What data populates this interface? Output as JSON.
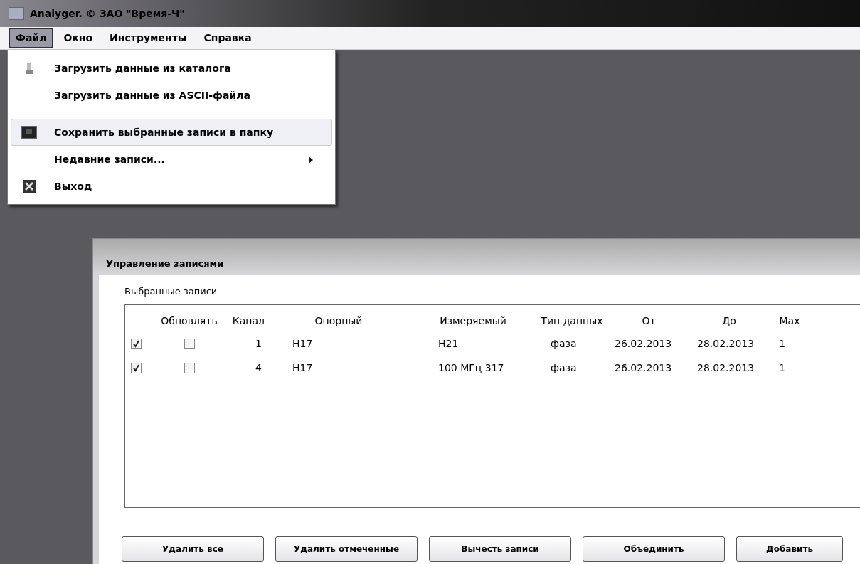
{
  "window": {
    "title": "Analyger. © ЗАО \"Время-Ч\""
  },
  "menu_bar": [
    {
      "label": "Файл",
      "selected": true
    },
    {
      "label": "Окно",
      "selected": false
    },
    {
      "label": "Инструменты",
      "selected": false
    },
    {
      "label": "Справка",
      "selected": false
    }
  ],
  "file_menu": [
    {
      "label": "Загрузить данные из каталога",
      "kind": "load",
      "highlighted": false,
      "submenu": false,
      "separator_after": false
    },
    {
      "label": "Загрузить данные из ASCII-файла",
      "kind": "plain",
      "highlighted": false,
      "submenu": false,
      "separator_after": true
    },
    {
      "label": "Сохранить выбранные записи в папку",
      "kind": "save",
      "highlighted": true,
      "submenu": false,
      "separator_after": false
    },
    {
      "label": "Недавние записи...",
      "kind": "plain",
      "highlighted": false,
      "submenu": true,
      "separator_after": false
    },
    {
      "label": "Выход",
      "kind": "exit",
      "highlighted": false,
      "submenu": false,
      "separator_after": false
    }
  ],
  "dialog": {
    "title": "Управление записями",
    "group_label": "Выбранные записи",
    "columns": [
      "Обновлять",
      "Канал",
      "Опорный",
      "Измеряемый",
      "Тип данных",
      "От",
      "До",
      "Мах"
    ],
    "rows": [
      {
        "checked": true,
        "update": false,
        "channel": "1",
        "reference": "H17",
        "measured": "H21",
        "data_type": "фаза",
        "from": "26.02.2013",
        "to": "28.02.2013",
        "max": "1"
      },
      {
        "checked": true,
        "update": false,
        "channel": "4",
        "reference": "H17",
        "measured": "100 МГц 317",
        "data_type": "фаза",
        "from": "26.02.2013",
        "to": "28.02.2013",
        "max": "1"
      }
    ],
    "buttons": [
      "Удалить все",
      "Удалить отмеченные",
      "Вычесть записи",
      "Объединить",
      "Добавить"
    ]
  }
}
